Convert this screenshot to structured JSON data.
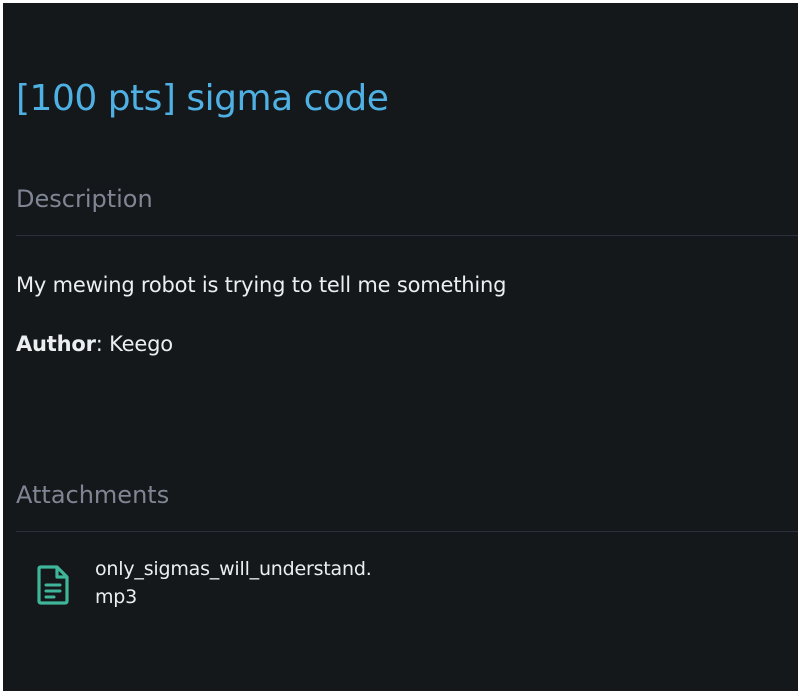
{
  "challenge": {
    "title": "[100 pts] sigma code"
  },
  "description": {
    "heading": "Description",
    "text": "My mewing robot is trying to tell me something",
    "author_label": "Author",
    "author_separator": ": ",
    "author_name": "Keego"
  },
  "attachments": {
    "heading": "Attachments",
    "items": [
      {
        "icon": "file-document-icon",
        "filename_line1": "only_sigmas_will_understand.",
        "filename_line2": "mp3"
      }
    ]
  },
  "colors": {
    "background": "#14181b",
    "title": "#4fb0e3",
    "heading": "#7f8593",
    "text": "#eceef0",
    "icon": "#3fb59a",
    "divider": "#2b3040"
  }
}
